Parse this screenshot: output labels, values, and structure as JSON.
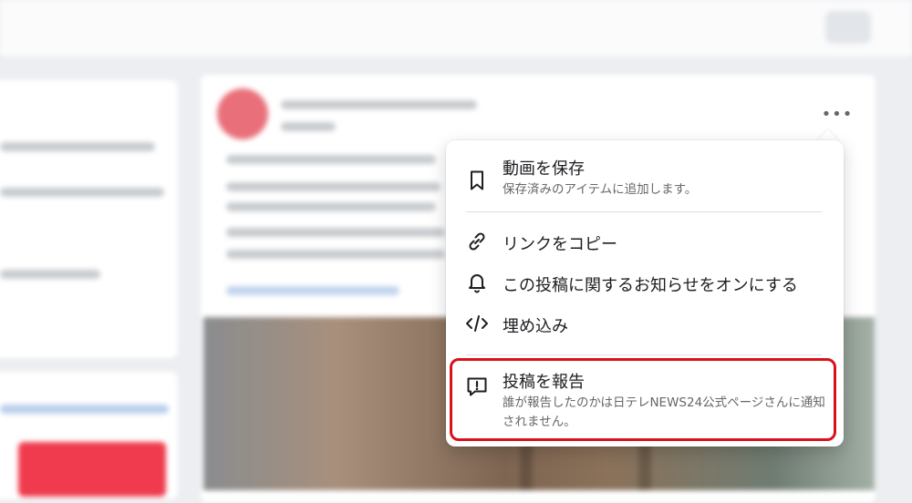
{
  "post": {
    "more_button_glyph": "•••"
  },
  "menu": {
    "save_video": {
      "icon": "bookmark-icon",
      "label": "動画を保存",
      "description": "保存済みのアイテムに追加します。"
    },
    "copy_link": {
      "icon": "link-icon",
      "label": "リンクをコピー"
    },
    "notifications": {
      "icon": "bell-icon",
      "label": "この投稿に関するお知らせをオンにする"
    },
    "embed": {
      "icon": "code-icon",
      "label": "埋め込み"
    },
    "report": {
      "icon": "report-icon",
      "label": "投稿を報告",
      "description": "誰が報告したのかは日テレNEWS24公式ページさんに通知されません。"
    }
  },
  "colors": {
    "highlight": "#d8121c",
    "text_primary": "#1c1e21",
    "text_secondary": "#65676b"
  }
}
